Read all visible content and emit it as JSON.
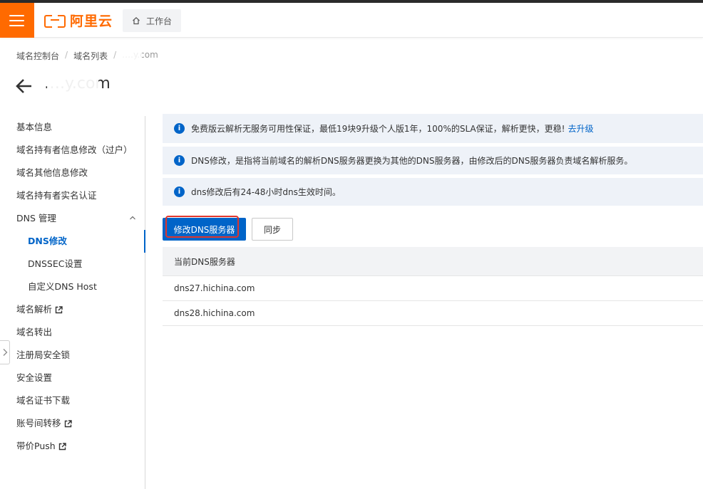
{
  "header": {
    "logo_text": "阿里云",
    "workbench_label": "工作台"
  },
  "breadcrumb": [
    "域名控制台",
    "域名列表",
    "….y.com"
  ],
  "page_title": "….y.com",
  "sidebar": {
    "items": [
      {
        "label": "基本信息"
      },
      {
        "label": "域名持有者信息修改（过户）"
      },
      {
        "label": "域名其他信息修改"
      },
      {
        "label": "域名持有者实名认证"
      },
      {
        "label": "DNS 管理"
      },
      {
        "label": "DNS修改"
      },
      {
        "label": "DNSSEC设置"
      },
      {
        "label": "自定义DNS Host"
      },
      {
        "label": "域名解析"
      },
      {
        "label": "域名转出"
      },
      {
        "label": "注册局安全锁"
      },
      {
        "label": "安全设置"
      },
      {
        "label": "域名证书下载"
      },
      {
        "label": "账号间转移"
      },
      {
        "label": "带价Push"
      }
    ]
  },
  "notices": [
    {
      "text": "免费版云解析无服务可用性保证，最低19块9升级个人版1年，100%的SLA保证，解析更快，更稳!",
      "link": "去升级"
    },
    {
      "text": "DNS修改，是指将当前域名的解析DNS服务器更换为其他的DNS服务器，由修改后的DNS服务器负责域名解析服务。"
    },
    {
      "text": "dns修改后有24-48小时dns生效时间。"
    }
  ],
  "buttons": {
    "modify_dns": "修改DNS服务器",
    "sync": "同步"
  },
  "table": {
    "header": "当前DNS服务器",
    "rows": [
      "dns27.hichina.com",
      "dns28.hichina.com"
    ]
  },
  "colors": {
    "brand_orange": "#ff6a00",
    "primary_blue": "#0064c8",
    "highlight_red": "#e0352b"
  }
}
